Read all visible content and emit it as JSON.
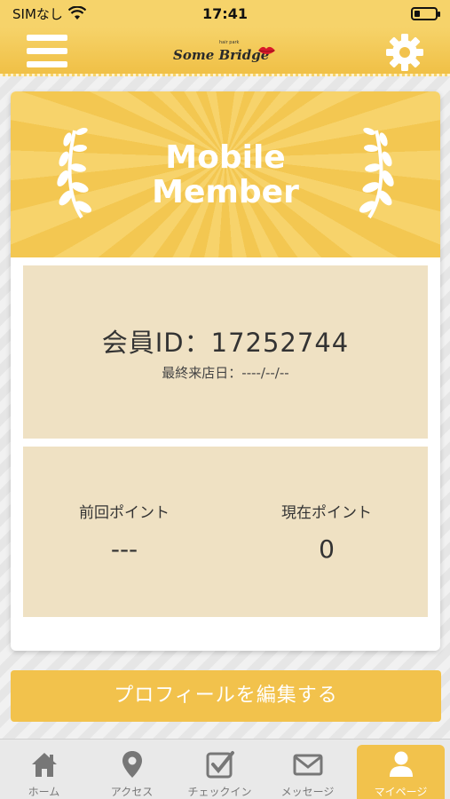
{
  "status_bar": {
    "carrier": "SIMなし",
    "time": "17:41",
    "battery_level": 0.25
  },
  "header": {
    "logo_small": "hair park",
    "logo_text": "Some Bridge",
    "menu_icon": "hamburger-icon",
    "settings_icon": "gear-icon"
  },
  "banner": {
    "title_line1": "Mobile",
    "title_line2": "Member"
  },
  "member": {
    "id_text": "会員ID：17252744",
    "last_visit": "最終来店日：----/--/--"
  },
  "points": {
    "previous_label": "前回ポイント",
    "previous_value": "---",
    "current_label": "現在ポイント",
    "current_value": "0"
  },
  "actions": {
    "edit_profile": "プロフィールを編集する"
  },
  "tabs": [
    {
      "label": "ホーム",
      "icon": "home-icon",
      "active": false
    },
    {
      "label": "アクセス",
      "icon": "map-pin-icon",
      "active": false
    },
    {
      "label": "チェックイン",
      "icon": "checkin-icon",
      "active": false
    },
    {
      "label": "メッセージ",
      "icon": "mail-icon",
      "active": false
    },
    {
      "label": "マイページ",
      "icon": "user-icon",
      "active": true
    }
  ],
  "colors": {
    "accent": "#f2c24c",
    "panel": "#efe1c3",
    "logo_lips": "#d8192a"
  }
}
